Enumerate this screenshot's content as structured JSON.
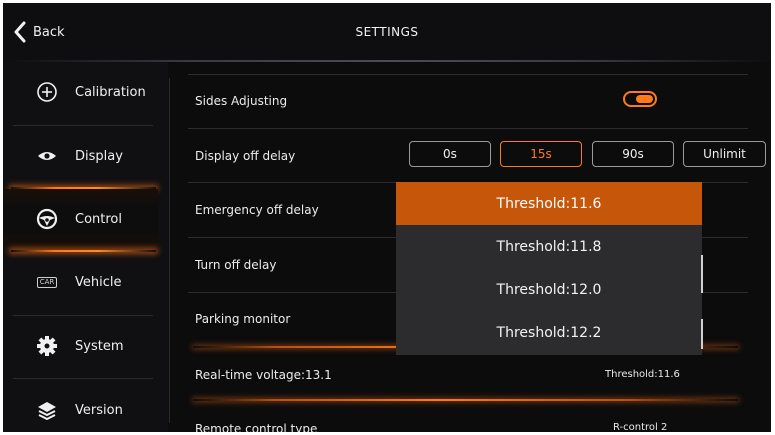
{
  "header": {
    "back_label": "Back",
    "title": "SETTINGS"
  },
  "sidebar": {
    "items": [
      {
        "label": "Calibration",
        "icon": "plus-circle-icon"
      },
      {
        "label": "Display",
        "icon": "eye-icon"
      },
      {
        "label": "Control",
        "icon": "steering-wheel-icon",
        "active": true
      },
      {
        "label": "Vehicle",
        "icon": "car-badge-icon",
        "icon_text": "CAR"
      },
      {
        "label": "System",
        "icon": "gear-icon"
      },
      {
        "label": "Version",
        "icon": "layers-icon"
      }
    ]
  },
  "settings": {
    "sides_adjusting": {
      "label": "Sides Adjusting",
      "enabled": true
    },
    "display_off_delay": {
      "label": "Display off delay",
      "options": [
        "0s",
        "15s",
        "90s",
        "Unlimit"
      ],
      "selected": "15s"
    },
    "emergency_off_delay": {
      "label": "Emergency off delay"
    },
    "turn_off_delay": {
      "label": "Turn off delay"
    },
    "parking_monitor": {
      "label": "Parking monitor"
    },
    "real_time_voltage": {
      "label": "Real-time voltage:13.1",
      "value": "Threshold:11.6"
    },
    "remote_control_type": {
      "label": "Remote control type",
      "value": "R-control 2"
    }
  },
  "dropdown": {
    "options": [
      "Threshold:11.6",
      "Threshold:11.8",
      "Threshold:12.0",
      "Threshold:12.2"
    ],
    "selected": "Threshold:11.6"
  },
  "colors": {
    "accent": "#ff7a18",
    "selected_item": "#c5560a",
    "background": "#0c0c0d"
  }
}
